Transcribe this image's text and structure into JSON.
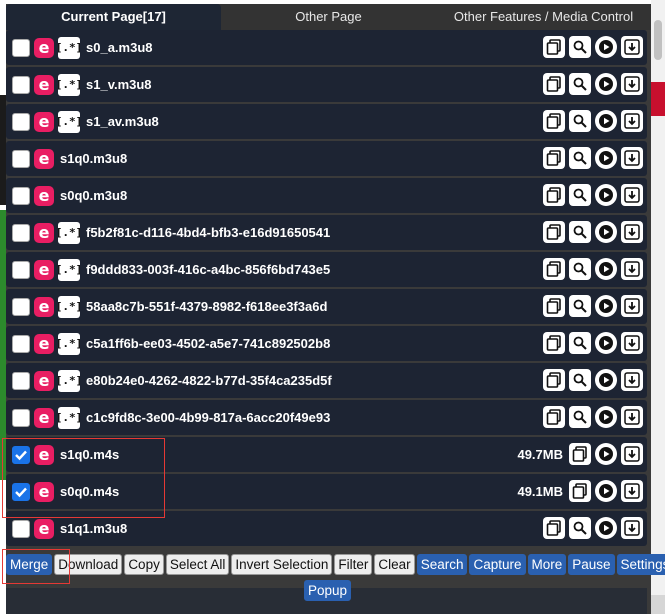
{
  "tabs": [
    {
      "label": "Current Page[17]",
      "active": true
    },
    {
      "label": "Other Page",
      "active": false
    },
    {
      "label": "Other Features / Media Control",
      "active": false
    }
  ],
  "rows": [
    {
      "name": "s0_a.m3u8",
      "checked": false,
      "regex": true,
      "size": ""
    },
    {
      "name": "s1_v.m3u8",
      "checked": false,
      "regex": true,
      "size": ""
    },
    {
      "name": "s1_av.m3u8",
      "checked": false,
      "regex": true,
      "size": ""
    },
    {
      "name": "s1q0.m3u8",
      "checked": false,
      "regex": false,
      "size": ""
    },
    {
      "name": "s0q0.m3u8",
      "checked": false,
      "regex": false,
      "size": ""
    },
    {
      "name": "f5b2f81c-d116-4bd4-bfb3-e16d91650541",
      "checked": false,
      "regex": true,
      "size": ""
    },
    {
      "name": "f9ddd833-003f-416c-a4bc-856f6bd743e5",
      "checked": false,
      "regex": true,
      "size": ""
    },
    {
      "name": "58aa8c7b-551f-4379-8982-f618ee3f3a6d",
      "checked": false,
      "regex": true,
      "size": ""
    },
    {
      "name": "c5a1ff6b-ee03-4502-a5e7-741c892502b8",
      "checked": false,
      "regex": true,
      "size": ""
    },
    {
      "name": "e80b24e0-4262-4822-b77d-35f4ca235d5f",
      "checked": false,
      "regex": true,
      "size": ""
    },
    {
      "name": "c1c9fd8c-3e00-4b99-817a-6acc20f49e93",
      "checked": false,
      "regex": true,
      "size": ""
    },
    {
      "name": "s1q0.m4s",
      "checked": true,
      "regex": false,
      "size": "49.7MB"
    },
    {
      "name": "s0q0.m4s",
      "checked": true,
      "regex": false,
      "size": "49.1MB"
    },
    {
      "name": "s1q1.m3u8",
      "checked": false,
      "regex": false,
      "size": ""
    }
  ],
  "toolbar": {
    "merge": "Merge",
    "download": "Download",
    "copy": "Copy",
    "select_all": "Select All",
    "invert_selection": "Invert Selection",
    "filter": "Filter",
    "clear": "Clear",
    "search": "Search",
    "capture": "Capture",
    "more": "More",
    "pause": "Pause",
    "settings": "Settings",
    "popup": "Popup"
  },
  "icons": {
    "row_logo": "e-logo-icon",
    "regex": "regex-icon",
    "copy": "copy-icon",
    "search": "search-icon",
    "play": "play-icon",
    "download": "download-icon",
    "checkbox_check": "checkmark-icon"
  },
  "colors": {
    "row_bg": "#1d2433",
    "accent_pink": "#e91e63",
    "button_blue": "#2a60b0",
    "highlight_red": "#e53935"
  }
}
